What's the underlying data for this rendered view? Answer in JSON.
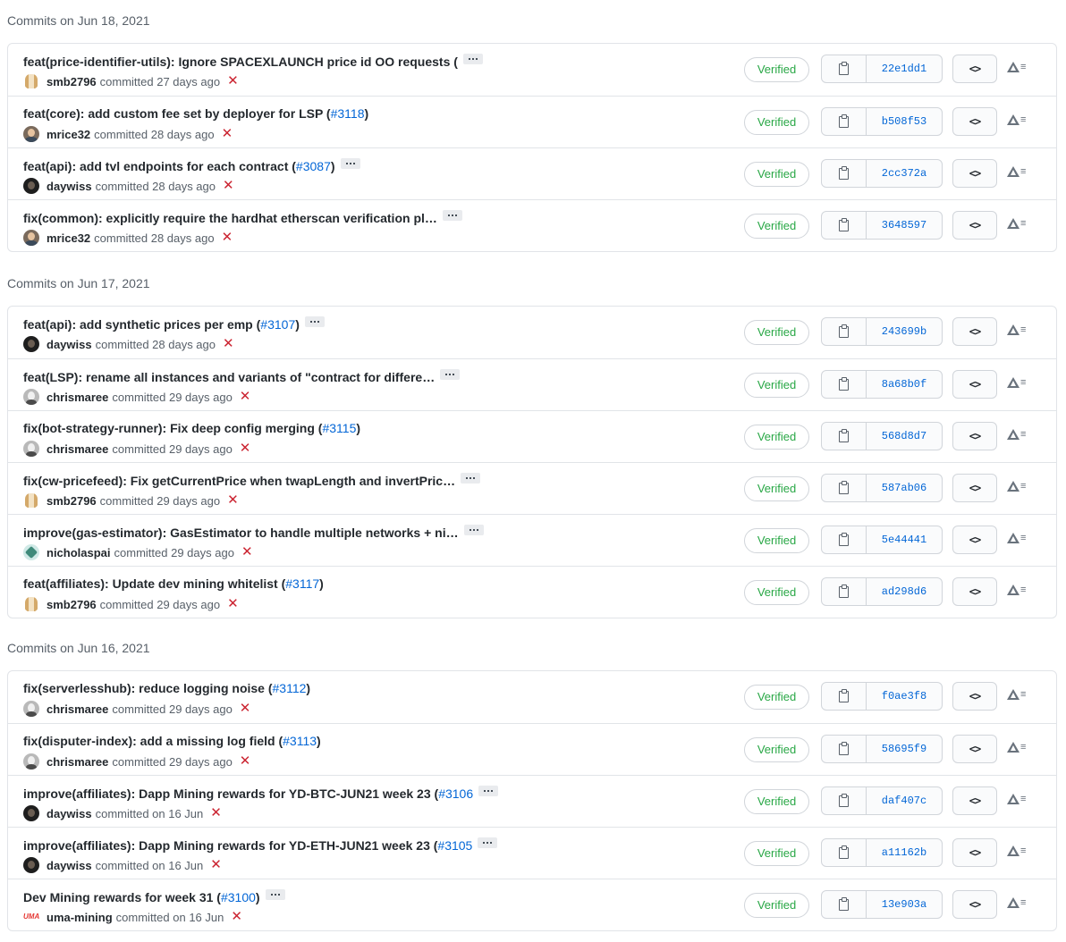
{
  "groups": [
    {
      "title": "Commits on Jun 18, 2021",
      "commits": [
        {
          "message": "feat(price-identifier-utils): Ignore SPACEXLAUNCH price id OO requests (",
          "pr": "",
          "suffix": "",
          "ellipsis": true,
          "avatar": "smb",
          "author": "smb2796",
          "time": "committed 27 days ago",
          "verified": "Verified",
          "sha": "22e1dd1"
        },
        {
          "message": "feat(core): add custom fee set by deployer for LSP (",
          "pr": "#3118",
          "suffix": ")",
          "ellipsis": false,
          "avatar": "mrice",
          "author": "mrice32",
          "time": "committed 28 days ago",
          "verified": "Verified",
          "sha": "b508f53"
        },
        {
          "message": "feat(api): add tvl endpoints for each contract (",
          "pr": "#3087",
          "suffix": ")",
          "ellipsis": true,
          "avatar": "day",
          "author": "daywiss",
          "time": "committed 28 days ago",
          "verified": "Verified",
          "sha": "2cc372a"
        },
        {
          "message": "fix(common): explicitly require the hardhat etherscan verification pl…",
          "pr": "",
          "suffix": "",
          "ellipsis": true,
          "avatar": "mrice",
          "author": "mrice32",
          "time": "committed 28 days ago",
          "verified": "Verified",
          "sha": "3648597"
        }
      ]
    },
    {
      "title": "Commits on Jun 17, 2021",
      "commits": [
        {
          "message": "feat(api): add synthetic prices per emp (",
          "pr": "#3107",
          "suffix": ")",
          "ellipsis": true,
          "avatar": "day",
          "author": "daywiss",
          "time": "committed 28 days ago",
          "verified": "Verified",
          "sha": "243699b"
        },
        {
          "message": "feat(LSP): rename all instances and variants of \"contract for differe…",
          "pr": "",
          "suffix": "",
          "ellipsis": true,
          "avatar": "chris",
          "author": "chrismaree",
          "time": "committed 29 days ago",
          "verified": "Verified",
          "sha": "8a68b0f"
        },
        {
          "message": "fix(bot-strategy-runner): Fix deep config merging (",
          "pr": "#3115",
          "suffix": ")",
          "ellipsis": false,
          "avatar": "chris",
          "author": "chrismaree",
          "time": "committed 29 days ago",
          "verified": "Verified",
          "sha": "568d8d7"
        },
        {
          "message": "fix(cw-pricefeed): Fix getCurrentPrice when twapLength and invertPric…",
          "pr": "",
          "suffix": "",
          "ellipsis": true,
          "avatar": "smb",
          "author": "smb2796",
          "time": "committed 29 days ago",
          "verified": "Verified",
          "sha": "587ab06"
        },
        {
          "message": "improve(gas-estimator): GasEstimator to handle multiple networks + ni…",
          "pr": "",
          "suffix": "",
          "ellipsis": true,
          "avatar": "nich",
          "author": "nicholaspai",
          "time": "committed 29 days ago",
          "verified": "Verified",
          "sha": "5e44441"
        },
        {
          "message": "feat(affiliates): Update dev mining whitelist (",
          "pr": "#3117",
          "suffix": ")",
          "ellipsis": false,
          "avatar": "smb",
          "author": "smb2796",
          "time": "committed 29 days ago",
          "verified": "Verified",
          "sha": "ad298d6"
        }
      ]
    },
    {
      "title": "Commits on Jun 16, 2021",
      "commits": [
        {
          "message": "fix(serverlesshub): reduce logging noise (",
          "pr": "#3112",
          "suffix": ")",
          "ellipsis": false,
          "avatar": "chris",
          "author": "chrismaree",
          "time": "committed 29 days ago",
          "verified": "Verified",
          "sha": "f0ae3f8"
        },
        {
          "message": "fix(disputer-index): add a missing log field (",
          "pr": "#3113",
          "suffix": ")",
          "ellipsis": false,
          "avatar": "chris",
          "author": "chrismaree",
          "time": "committed 29 days ago",
          "verified": "Verified",
          "sha": "58695f9"
        },
        {
          "message": "improve(affiliates): Dapp Mining rewards for YD-BTC-JUN21 week 23 (",
          "pr": "#3106",
          "suffix": "",
          "ellipsis": true,
          "avatar": "day",
          "author": "daywiss",
          "time": "committed on 16 Jun",
          "verified": "Verified",
          "sha": "daf407c"
        },
        {
          "message": "improve(affiliates): Dapp Mining rewards for YD-ETH-JUN21 week 23 (",
          "pr": "#3105",
          "suffix": "",
          "ellipsis": true,
          "avatar": "day",
          "author": "daywiss",
          "time": "committed on 16 Jun",
          "verified": "Verified",
          "sha": "a11162b"
        },
        {
          "message": "Dev Mining rewards for week 31 (",
          "pr": "#3100",
          "suffix": ")",
          "ellipsis": true,
          "avatar": "uma",
          "avatar_text": "UMA",
          "author": "uma-mining",
          "time": "committed on 16 Jun",
          "verified": "Verified",
          "sha": "13e903a"
        }
      ]
    }
  ],
  "icons": {
    "status": "x-icon",
    "copy": "clipboard-icon",
    "browse": "code-icon",
    "extension": "warning-icon"
  },
  "colors": {
    "link": "#0366d6",
    "verified": "#28a745",
    "failed": "#cb2431",
    "border": "#e1e4e8"
  }
}
